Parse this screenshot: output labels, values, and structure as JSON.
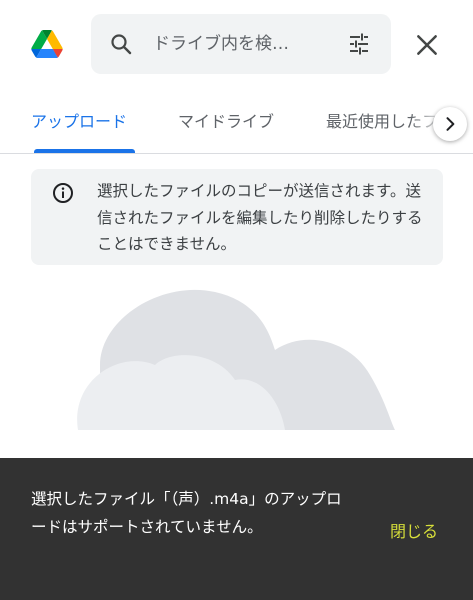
{
  "header": {
    "logo_icon": "google-drive-logo",
    "search_placeholder": "ドライブ内を検…",
    "search_icon": "search-icon",
    "filter_icon": "tune-icon",
    "close_icon": "close-icon"
  },
  "tabs": [
    {
      "label": "アップロード",
      "active": true
    },
    {
      "label": "マイドライブ",
      "active": false
    },
    {
      "label": "最近使用したファイル",
      "active": false
    }
  ],
  "tab_scroll_icon": "chevron-right-icon",
  "info_banner": {
    "icon": "info-icon",
    "text": "選択したファイルのコピーが送信されます。送信されたファイルを編集したり削除したりすることはできません。"
  },
  "snackbar": {
    "message": "選択したファイル「（声）.m4a」のアップロードはサポートされていません。",
    "action_label": "閉じる"
  },
  "colors": {
    "accent": "#1a73e8",
    "snackbar_bg": "#323232",
    "snackbar_action": "#d7df3a",
    "banner_bg": "#f1f3f4"
  }
}
